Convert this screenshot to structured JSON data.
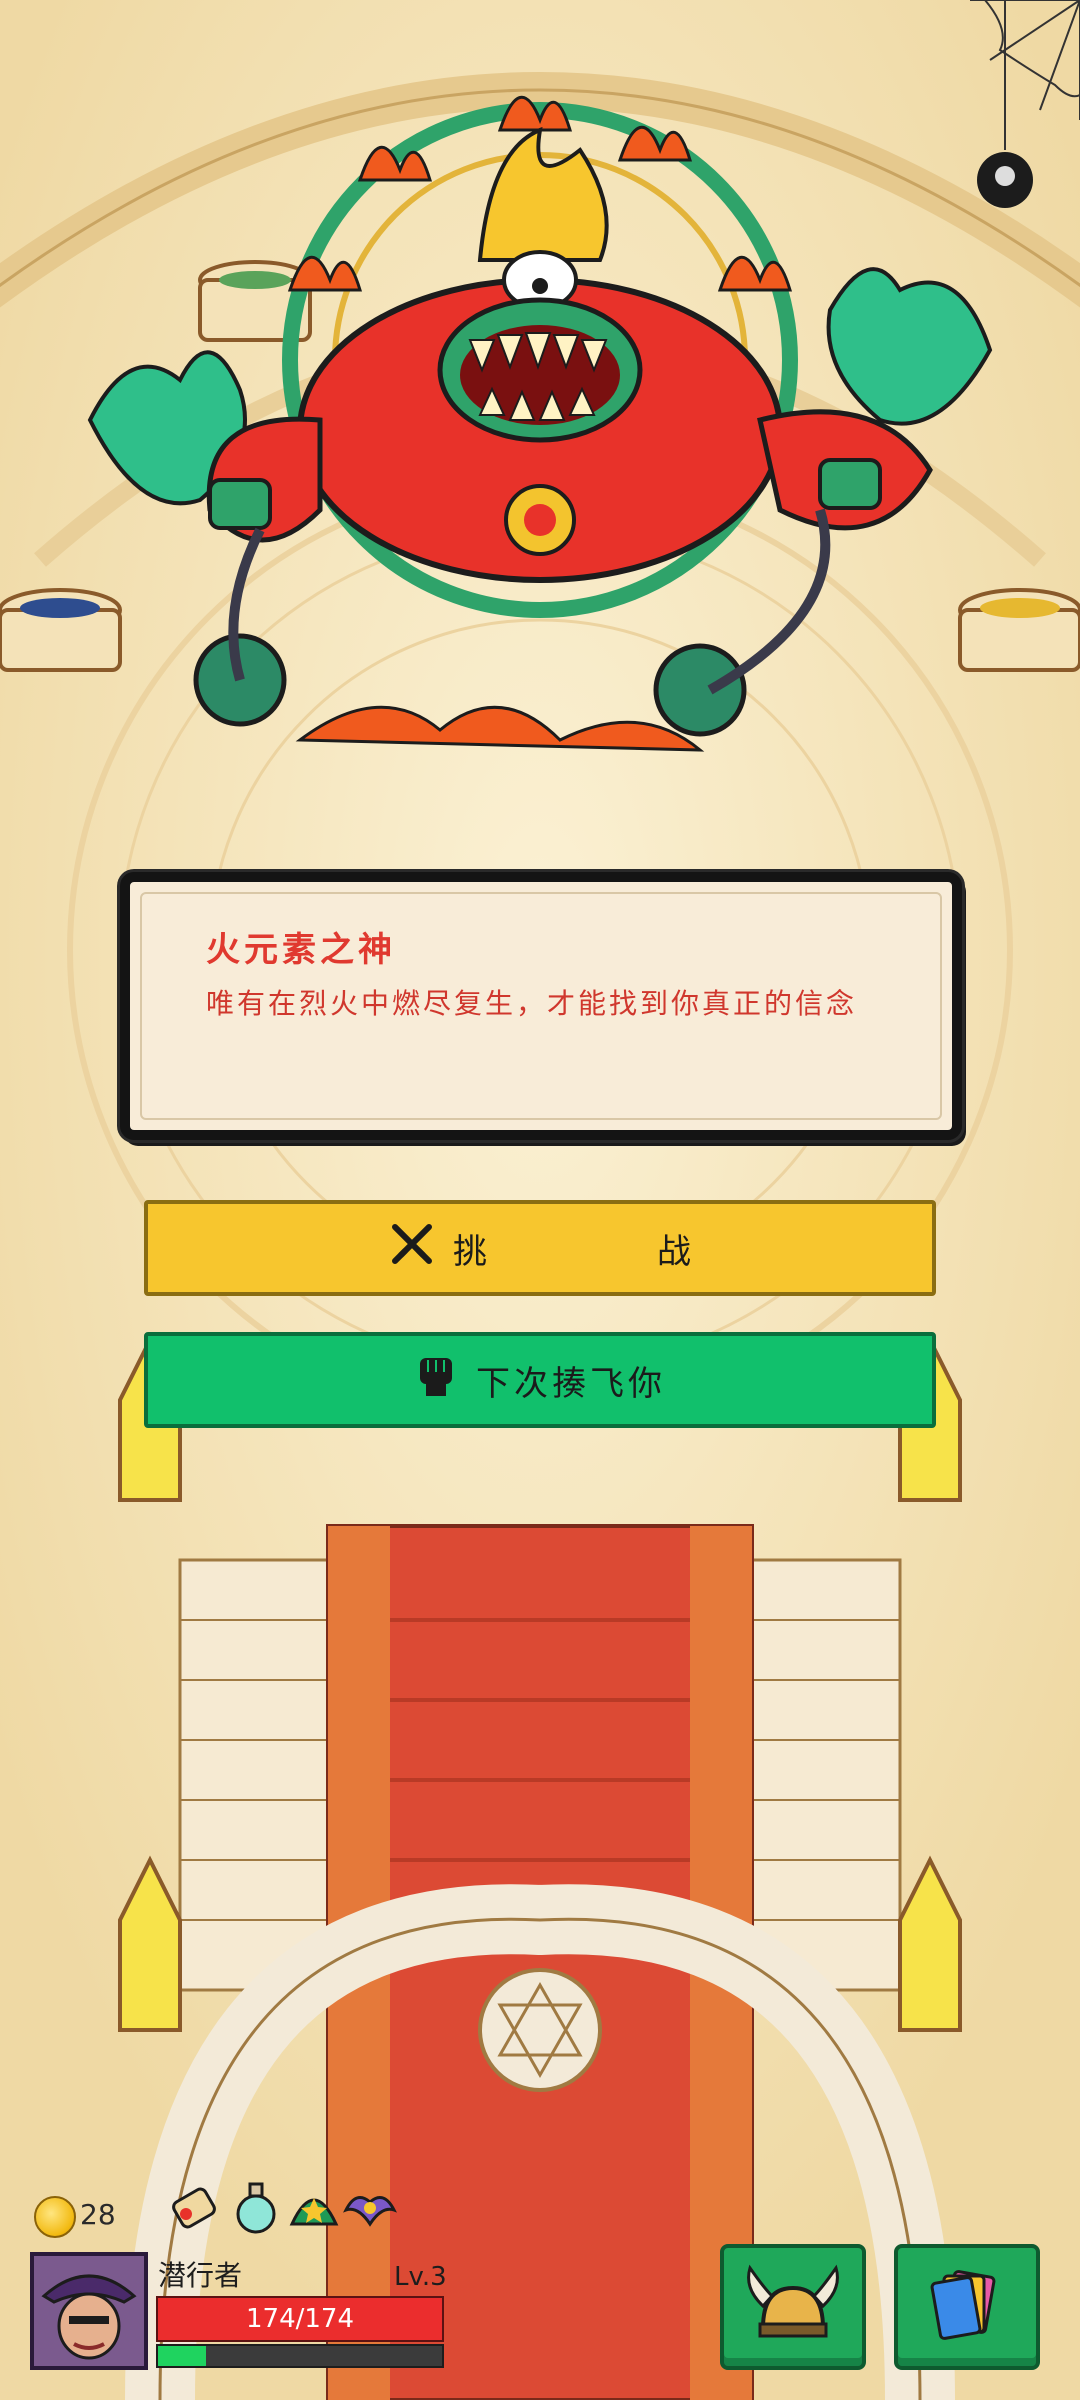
{
  "boss": {
    "name": "火元素之神",
    "dialog": "唯有在烈火中燃尽复生，才能找到你真正的信念"
  },
  "buttons": {
    "challenge_left": "挑",
    "challenge_right": "战",
    "flee": "下次揍飞你"
  },
  "player": {
    "coins": "28",
    "name": "潜行者",
    "level": "Lv.3",
    "hp": "174/174",
    "xp_fraction": 0.17
  },
  "icons": {
    "challenge": "crossed-swords-icon",
    "flee": "fist-icon",
    "inventory": [
      "scroll-icon",
      "potion-icon",
      "green-hat-icon",
      "purple-bat-icon"
    ],
    "menu_left": "viking-helmet-icon",
    "menu_right": "cards-icon"
  },
  "colors": {
    "challenge_button": "#f7c62e",
    "flee_button": "#11c06c",
    "boss_text": "#e0392f",
    "hp_bar": "#eb2d2d",
    "xp_bar": "#1fd35f"
  }
}
